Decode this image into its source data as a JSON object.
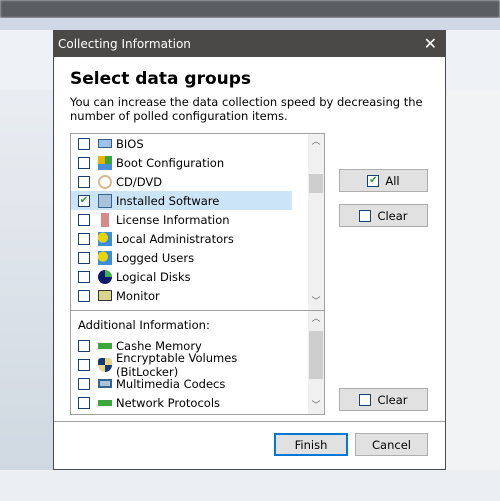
{
  "dialog": {
    "title": "Collecting Information",
    "heading": "Select data groups",
    "description": "You can increase the data collection speed by decreasing the number of polled configuration items.",
    "groups": [
      {
        "label": "BIOS",
        "checked": false,
        "icon": "chip-icon"
      },
      {
        "label": "Boot Configuration",
        "checked": false,
        "icon": "boot-tiles-icon"
      },
      {
        "label": "CD/DVD",
        "checked": false,
        "icon": "disc-icon"
      },
      {
        "label": "Installed Software",
        "checked": true,
        "icon": "software-icon",
        "selected": true
      },
      {
        "label": "License Information",
        "checked": false,
        "icon": "key-icon"
      },
      {
        "label": "Local Administrators",
        "checked": false,
        "icon": "users-icon"
      },
      {
        "label": "Logged Users",
        "checked": false,
        "icon": "users-icon"
      },
      {
        "label": "Logical Disks",
        "checked": false,
        "icon": "pie-disk-icon"
      },
      {
        "label": "Monitor",
        "checked": false,
        "icon": "monitor-icon"
      }
    ],
    "additional_header": "Additional Information:",
    "additional": [
      {
        "label": "Cashe Memory",
        "checked": false,
        "icon": "memory-icon"
      },
      {
        "label": "Encryptable Volumes (BitLocker)",
        "checked": false,
        "icon": "shield-icon"
      },
      {
        "label": "Multimedia Codecs",
        "checked": false,
        "icon": "speaker-icon"
      },
      {
        "label": "Network Protocols",
        "checked": false,
        "icon": "network-icon"
      }
    ],
    "all_label": "All",
    "clear_label": "Clear",
    "clear2_label": "Clear",
    "finish_label": "Finish",
    "cancel_label": "Cancel"
  }
}
